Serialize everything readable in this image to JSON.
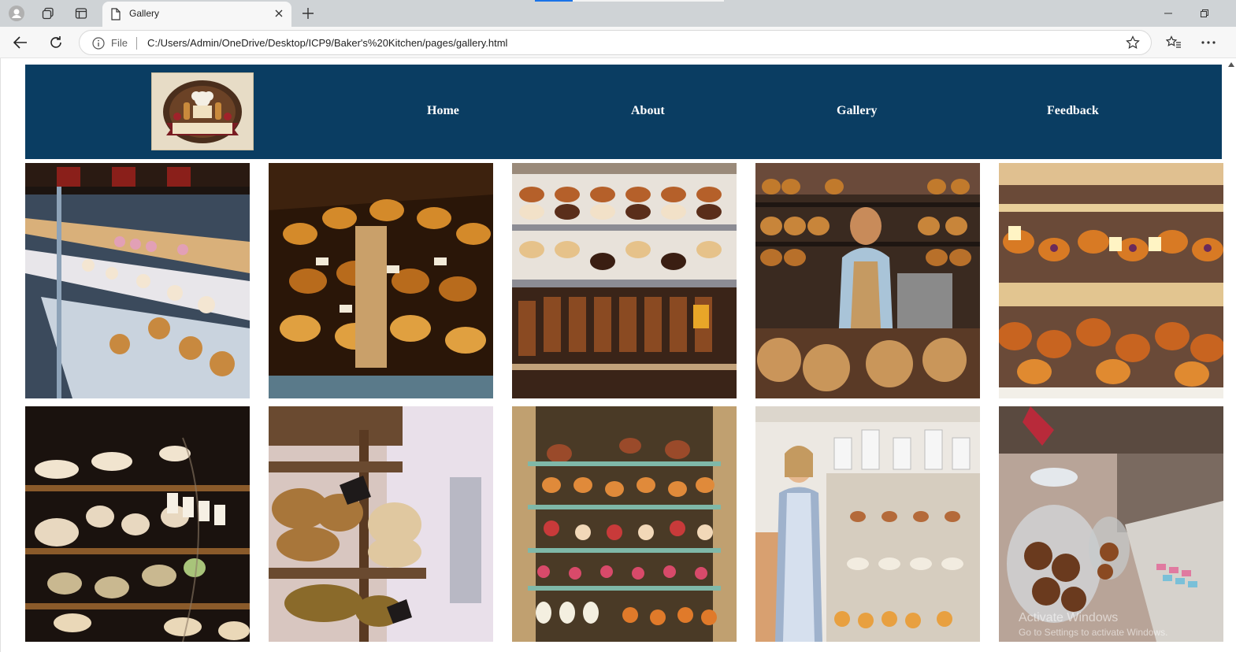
{
  "browser": {
    "tab_title": "Gallery",
    "address_scheme_label": "File",
    "url": "C:/Users/Admin/OneDrive/Desktop/ICP9/Baker's%20Kitchen/pages/gallery.html"
  },
  "site": {
    "logo_text": "BAKERS KITCHEN",
    "nav": [
      "Home",
      "About",
      "Gallery",
      "Feedback"
    ],
    "header_color": "#0a3d62"
  },
  "gallery": {
    "images": [
      "bakery-display-case-cakes",
      "pastry-counter-croissants",
      "cake-shelves-display",
      "baker-woman-bread-shelves",
      "danish-pastries-shelves",
      "dark-glass-case-desserts",
      "bread-loaves-wooden-shelf",
      "colorful-cake-tiers-window",
      "smiling-baker-at-counter",
      "cookie-jars-counter"
    ]
  },
  "os_watermark": {
    "line1": "Activate Windows",
    "line2": "Go to Settings to activate Windows."
  }
}
